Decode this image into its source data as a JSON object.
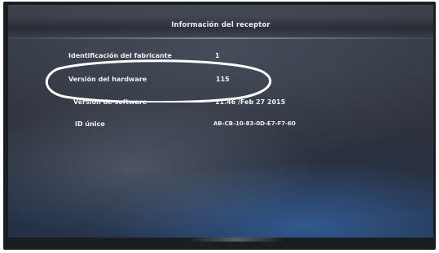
{
  "screen": {
    "title": "Información del receptor"
  },
  "info_rows": [
    {
      "label": "Identificación del fabricante",
      "value": "1"
    },
    {
      "label": "Versión del hardware",
      "value": "115"
    },
    {
      "label": "Versión de software",
      "value": "11.46 /Feb 27 2015"
    },
    {
      "label": "ID único",
      "value": "AB-CB-10-83-0D-E7-F7-60"
    }
  ],
  "annotation": {
    "type": "hand-drawn ellipse",
    "color": "#ffffff",
    "highlights": "Versión del hardware"
  },
  "colors": {
    "text": "#eef1f6",
    "screen_top": "#3a404a",
    "screen_bottom_glow": "#3c78c8",
    "bezel": "#1a1d22"
  }
}
